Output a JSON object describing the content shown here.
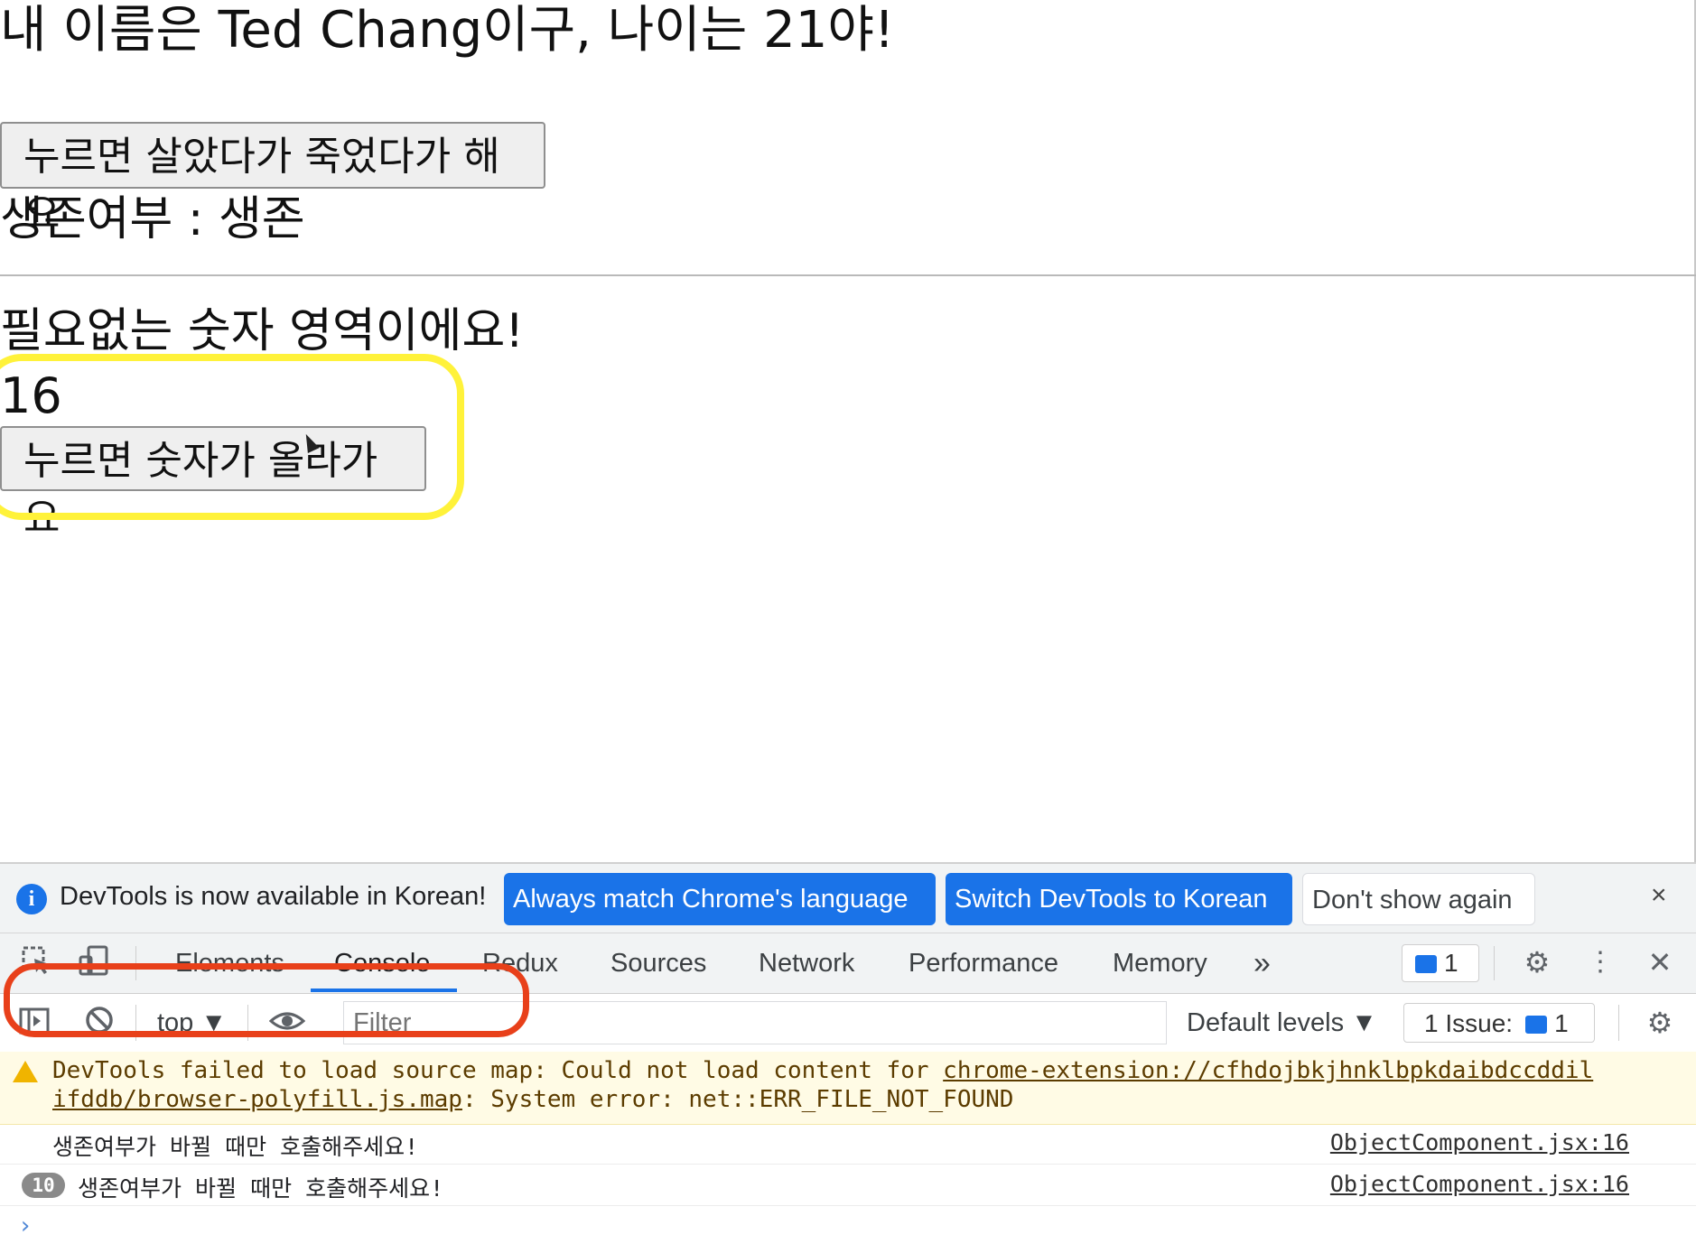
{
  "page": {
    "greeting": "내 이름은 Ted Chang이구, 나이는 21야!",
    "toggle_button": "누르면 살았다가 죽었다가 해요",
    "alive_status": "생존여부 : 생존",
    "number_title": "필요없는 숫자 영역이에요!",
    "counter_value": "16",
    "increment_button": "누르면 숫자가 올라가요"
  },
  "devtools": {
    "banner": {
      "text": "DevTools is now available in Korean!",
      "match_language": "Always match Chrome's language",
      "switch_korean": "Switch DevTools to Korean",
      "dont_show": "Don't show again",
      "close": "×"
    },
    "tabs": [
      "Elements",
      "Console",
      "Redux",
      "Sources",
      "Network",
      "Performance",
      "Memory"
    ],
    "more_tabs": "»",
    "message_count": "1",
    "toolbar": {
      "context": "top ▼",
      "filter_placeholder": "Filter",
      "levels": "Default levels ▼",
      "issues_label": "1 Issue:",
      "issues_count": "1"
    },
    "warning": {
      "line1_prefix": "DevTools failed to load source map: Could not load content for ",
      "line1_link": "chrome-extension://cfhdojbkjhnklbpkdaibdccddil",
      "line2_link": "ifddb/browser-polyfill.js.map",
      "line2_suffix": ": System error: net::ERR_FILE_NOT_FOUND"
    },
    "logs": [
      {
        "message": "생존여부가 바뀔 때만 호출해주세요!",
        "source": "ObjectComponent.jsx:16"
      },
      {
        "count": "10",
        "message": "생존여부가 바뀔 때만 호출해주세요!",
        "source": "ObjectComponent.jsx:16"
      }
    ],
    "prompt": "›",
    "colors": {
      "accent": "#1a73e8",
      "highlight_yellow": "#fff23a",
      "highlight_red": "#e8401a"
    }
  }
}
